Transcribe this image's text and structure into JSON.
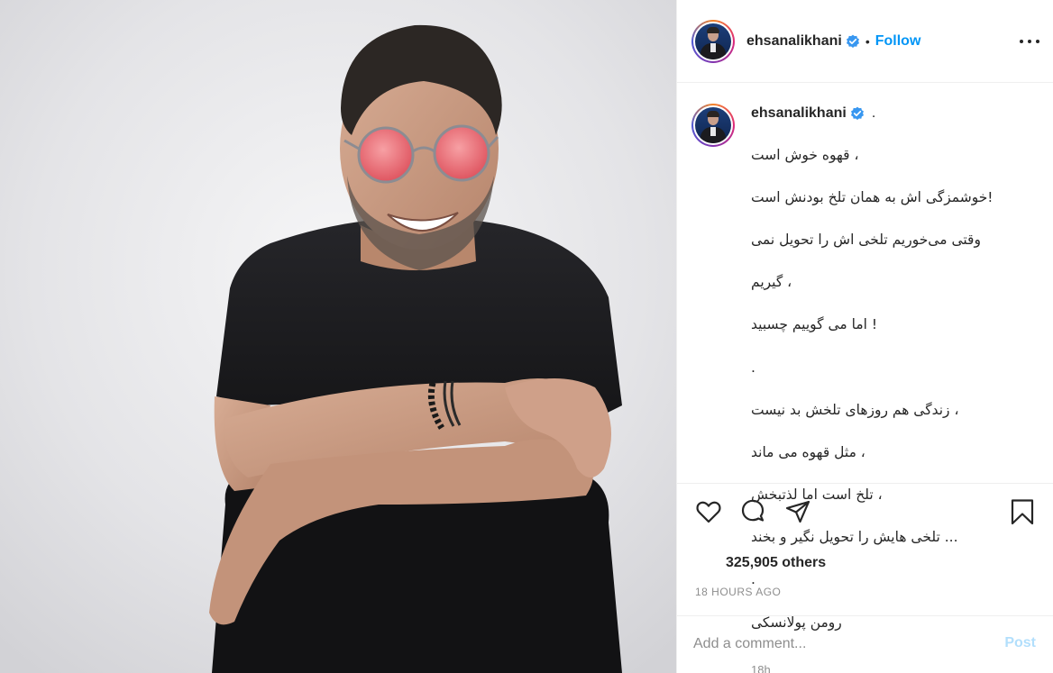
{
  "photo": {
    "alt_subject": "portrait-photo",
    "colors": {
      "background": "#e4e4e7",
      "shirt": "#1e1e21",
      "skin": "#c79a82",
      "glasses": "#e8606a"
    }
  },
  "post": {
    "username": "ehsanalikhani",
    "follow_label": "Follow",
    "separator": "•",
    "caption_user": "ehsanalikhani",
    "caption_trailing": ".",
    "caption_lines": [
      "، قهوه خوش است",
      "!خوشمزگی اش به همان تلخ بودنش است",
      "وقتی می‌خوریم تلخی اش را تحویل نمی",
      "، گیریم",
      "! اما می گوییم چسبید",
      ".",
      "، زندگی هم روزهای تلخش بد نیست",
      "، مثل قهوه می ماند",
      "، تلخ است اما لذتبخش",
      "... تلخی هایش را تحویل نگیر و بخند",
      ".",
      "رومن پولانسکی"
    ],
    "caption_time": "18h",
    "likes": "325,905 others",
    "posted_ago": "18 HOURS AGO",
    "comment_placeholder": "Add a comment...",
    "post_label": "Post"
  },
  "colors": {
    "link_blue": "#0095f6",
    "post_disabled": "#b2dffc",
    "muted": "#8e8e8e",
    "text": "#262626",
    "border": "#efefef"
  },
  "icons": [
    "verified-badge-icon",
    "more-options-icon",
    "heart-icon",
    "comment-icon",
    "share-icon",
    "bookmark-icon"
  ]
}
